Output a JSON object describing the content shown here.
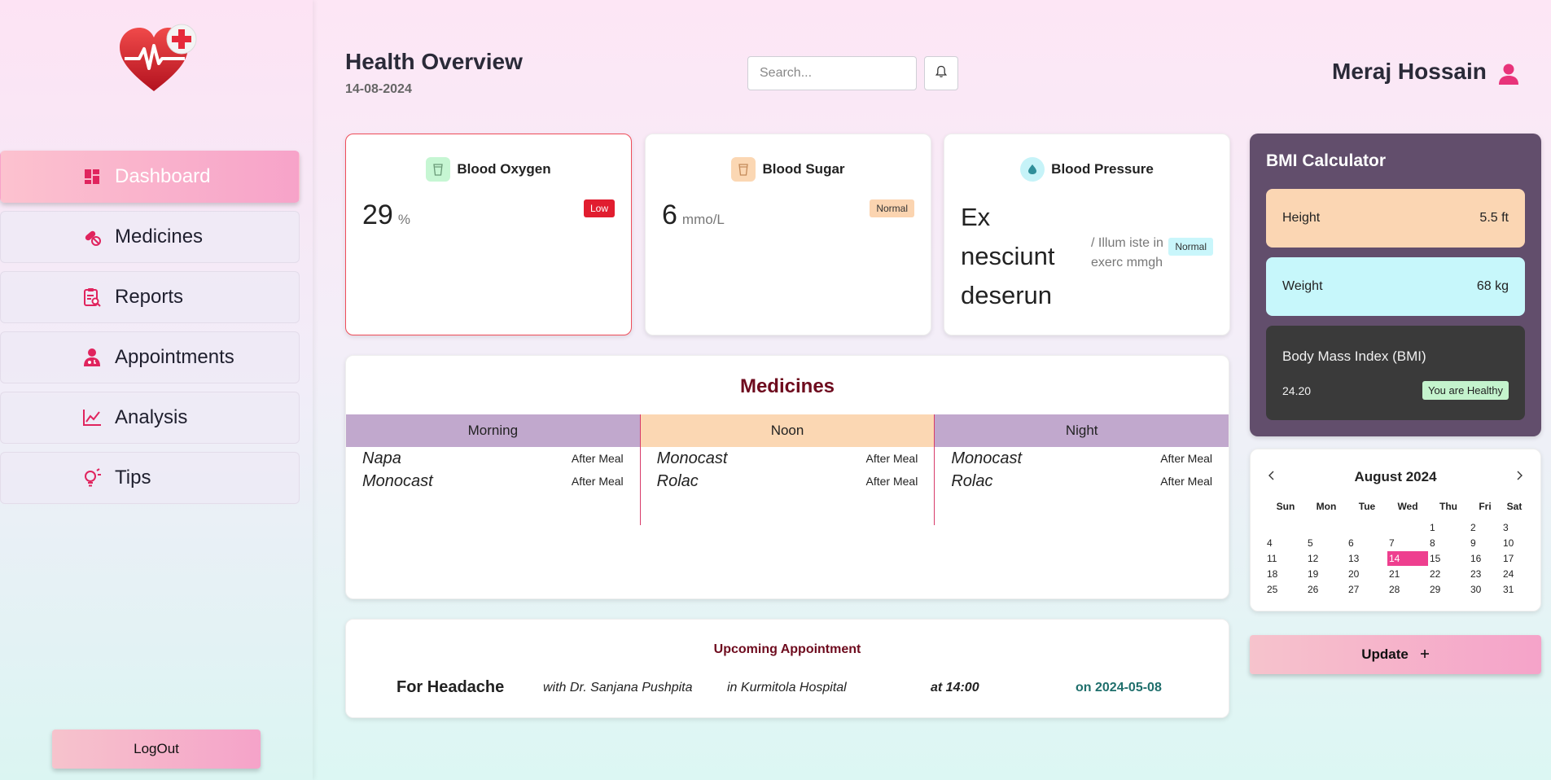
{
  "sidebar": {
    "nav": [
      {
        "label": "Dashboard",
        "icon": "dashboard-icon",
        "active": true
      },
      {
        "label": "Medicines",
        "icon": "pills-icon"
      },
      {
        "label": "Reports",
        "icon": "clipboard-icon"
      },
      {
        "label": "Appointments",
        "icon": "doctor-icon"
      },
      {
        "label": "Analysis",
        "icon": "chart-line-icon"
      },
      {
        "label": "Tips",
        "icon": "lightbulb-icon"
      }
    ],
    "logout_label": "LogOut"
  },
  "header": {
    "title": "Health Overview",
    "date": "14-08-2024",
    "search_placeholder": "Search...",
    "user_name": "Meraj Hossain"
  },
  "vitals": {
    "oxygen": {
      "title": "Blood Oxygen",
      "value": "29",
      "unit": "%",
      "status": "Low"
    },
    "sugar": {
      "title": "Blood Sugar",
      "value": "6",
      "unit": "mmo/L",
      "status": "Normal"
    },
    "pressure": {
      "title": "Blood Pressure",
      "value": "Ex nesciunt deserun",
      "unit": "/ Illum iste in exerc mmgh",
      "status": "Normal"
    }
  },
  "medicines": {
    "title": "Medicines",
    "columns": [
      {
        "label": "Morning",
        "items": [
          {
            "name": "Napa",
            "when": "After Meal"
          },
          {
            "name": "Monocast",
            "when": "After Meal"
          }
        ]
      },
      {
        "label": "Noon",
        "items": [
          {
            "name": "Monocast",
            "when": "After Meal"
          },
          {
            "name": "Rolac",
            "when": "After Meal"
          }
        ]
      },
      {
        "label": "Night",
        "items": [
          {
            "name": "Monocast",
            "when": "After Meal"
          },
          {
            "name": "Rolac",
            "when": "After Meal"
          }
        ]
      }
    ]
  },
  "appointment": {
    "title": "Upcoming Appointment",
    "reason": "For Headache",
    "doctor": "with Dr. Sanjana Pushpita",
    "hospital": "in Kurmitola Hospital",
    "time": "at 14:00",
    "date": "on 2024-05-08"
  },
  "bmi": {
    "title": "BMI Calculator",
    "height_label": "Height",
    "height_value": "5.5 ft",
    "weight_label": "Weight",
    "weight_value": "68 kg",
    "result_label": "Body Mass Index (BMI)",
    "result_value": "24.20",
    "result_status": "You are Healthy"
  },
  "calendar": {
    "month": "August 2024",
    "weekdays": [
      "Sun",
      "Mon",
      "Tue",
      "Wed",
      "Thu",
      "Fri",
      "Sat"
    ],
    "weeks": [
      [
        "",
        "",
        "",
        "",
        "1",
        "2",
        "3"
      ],
      [
        "4",
        "5",
        "6",
        "7",
        "8",
        "9",
        "10"
      ],
      [
        "11",
        "12",
        "13",
        "14",
        "15",
        "16",
        "17"
      ],
      [
        "18",
        "19",
        "20",
        "21",
        "22",
        "23",
        "24"
      ],
      [
        "25",
        "26",
        "27",
        "28",
        "29",
        "30",
        "31"
      ]
    ],
    "selected": "14"
  },
  "update_label": "Update",
  "colors": {
    "accent_pink": "#ee3f8f",
    "bmi_panel": "#624e6c",
    "low_badge": "#e11d2f",
    "maroon_title": "#6e0b1e",
    "date_teal": "#1f6f6c"
  }
}
